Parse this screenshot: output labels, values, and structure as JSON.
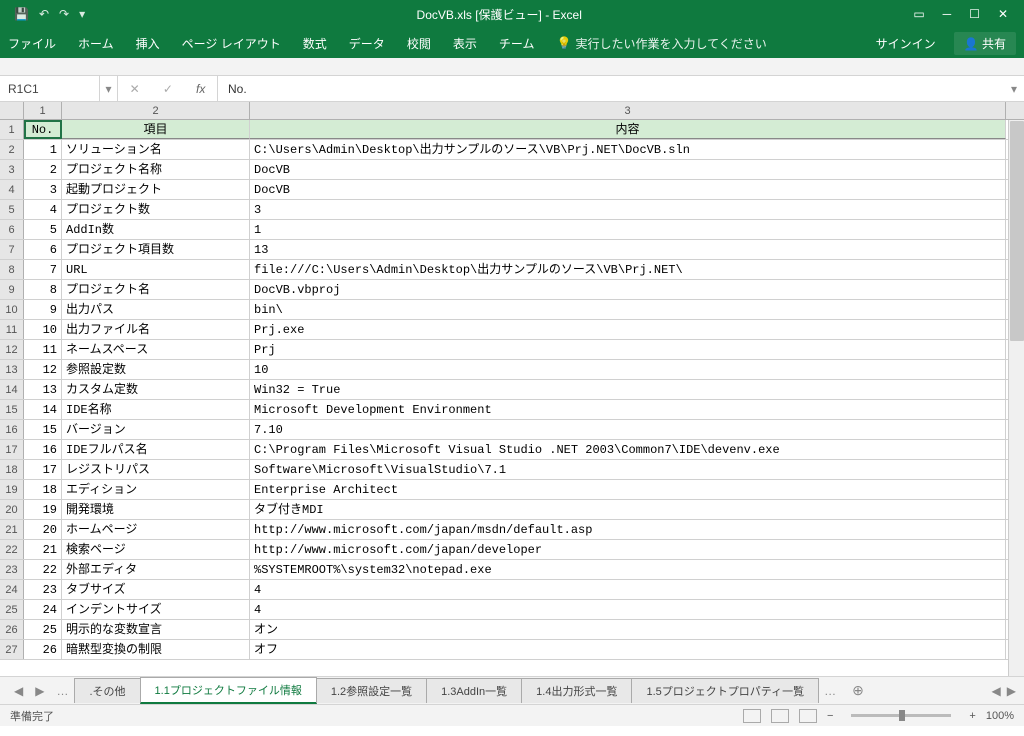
{
  "title": "DocVB.xls  [保護ビュー] - Excel",
  "ribbon": {
    "tabs": [
      "ファイル",
      "ホーム",
      "挿入",
      "ページ レイアウト",
      "数式",
      "データ",
      "校閲",
      "表示",
      "チーム"
    ],
    "tell_me": "実行したい作業を入力してください",
    "sign_in": "サインイン",
    "share": "共有"
  },
  "name_box": "R1C1",
  "formula": "No.",
  "columns": [
    "1",
    "2",
    "3"
  ],
  "header_row": {
    "no": "No.",
    "item": "項目",
    "content": "内容"
  },
  "rows": [
    {
      "r": "1",
      "no": "1",
      "item": "ソリューション名",
      "content": "C:\\Users\\Admin\\Desktop\\出力サンプルのソース\\VB\\Prj.NET\\DocVB.sln"
    },
    {
      "r": "2",
      "no": "2",
      "item": "プロジェクト名称",
      "content": "DocVB"
    },
    {
      "r": "3",
      "no": "3",
      "item": "起動プロジェクト",
      "content": "DocVB"
    },
    {
      "r": "4",
      "no": "4",
      "item": "プロジェクト数",
      "content": "3"
    },
    {
      "r": "5",
      "no": "5",
      "item": "AddIn数",
      "content": "1"
    },
    {
      "r": "6",
      "no": "6",
      "item": "プロジェクト項目数",
      "content": "13"
    },
    {
      "r": "7",
      "no": "7",
      "item": "URL",
      "content": "file:///C:\\Users\\Admin\\Desktop\\出力サンプルのソース\\VB\\Prj.NET\\"
    },
    {
      "r": "8",
      "no": "8",
      "item": "プロジェクト名",
      "content": "DocVB.vbproj"
    },
    {
      "r": "9",
      "no": "9",
      "item": "出力パス",
      "content": "bin\\"
    },
    {
      "r": "10",
      "no": "10",
      "item": "出力ファイル名",
      "content": "Prj.exe"
    },
    {
      "r": "11",
      "no": "11",
      "item": "ネームスペース",
      "content": "Prj"
    },
    {
      "r": "12",
      "no": "12",
      "item": "参照設定数",
      "content": "10"
    },
    {
      "r": "13",
      "no": "13",
      "item": "カスタム定数",
      "content": "Win32 = True"
    },
    {
      "r": "14",
      "no": "14",
      "item": "IDE名称",
      "content": "Microsoft Development Environment"
    },
    {
      "r": "15",
      "no": "15",
      "item": "バージョン",
      "content": "7.10"
    },
    {
      "r": "16",
      "no": "16",
      "item": "IDEフルパス名",
      "content": "C:\\Program Files\\Microsoft Visual Studio .NET 2003\\Common7\\IDE\\devenv.exe"
    },
    {
      "r": "17",
      "no": "17",
      "item": "レジストリパス",
      "content": "Software\\Microsoft\\VisualStudio\\7.1"
    },
    {
      "r": "18",
      "no": "18",
      "item": "エディション",
      "content": "Enterprise Architect"
    },
    {
      "r": "19",
      "no": "19",
      "item": "開発環境",
      "content": "タブ付きMDI"
    },
    {
      "r": "20",
      "no": "20",
      "item": "ホームページ",
      "content": "http://www.microsoft.com/japan/msdn/default.asp"
    },
    {
      "r": "21",
      "no": "21",
      "item": "検索ページ",
      "content": "http://www.microsoft.com/japan/developer"
    },
    {
      "r": "22",
      "no": "22",
      "item": "外部エディタ",
      "content": "%SYSTEMROOT%\\system32\\notepad.exe"
    },
    {
      "r": "23",
      "no": "23",
      "item": "タブサイズ",
      "content": "4"
    },
    {
      "r": "24",
      "no": "24",
      "item": "インデントサイズ",
      "content": "4"
    },
    {
      "r": "25",
      "no": "25",
      "item": "明示的な変数宣言",
      "content": "オン"
    },
    {
      "r": "26",
      "no": "26",
      "item": "暗黙型変換の制限",
      "content": "オフ"
    }
  ],
  "row_indices": [
    "1",
    "2",
    "3",
    "4",
    "5",
    "6",
    "7",
    "8",
    "9",
    "10",
    "11",
    "12",
    "13",
    "14",
    "15",
    "16",
    "17",
    "18",
    "19",
    "20",
    "21",
    "22",
    "23",
    "24",
    "25",
    "26",
    "27"
  ],
  "sheet_tabs": {
    "other": ".その他",
    "active": "1.1プロジェクトファイル情報",
    "t3": "1.2参照設定一覧",
    "t4": "1.3AddIn一覧",
    "t5": "1.4出力形式一覧",
    "t6": "1.5プロジェクトプロパティ一覧"
  },
  "status": {
    "ready": "準備完了",
    "zoom": "100%"
  }
}
